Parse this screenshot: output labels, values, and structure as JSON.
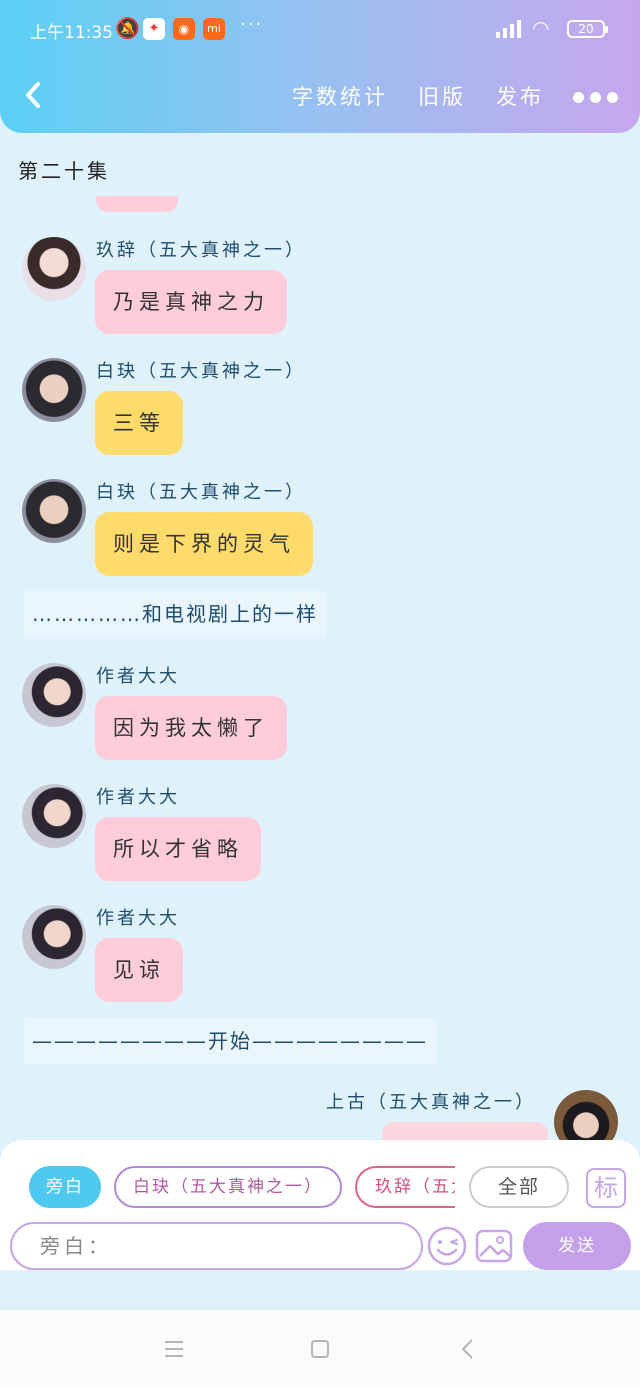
{
  "status_bar": {
    "time": "上午11:35",
    "battery": "20",
    "app_icons": [
      "app-icon-1",
      "app-icon-2",
      "mi-icon"
    ],
    "icon_names": [
      "bell-off-icon",
      "signal-icon",
      "wifi-icon",
      "battery-icon"
    ]
  },
  "nav": {
    "word_count": "字数统计",
    "old_version": "旧版",
    "publish": "发布"
  },
  "chapter_title": "第二十集",
  "messages": [
    {
      "sender": "玖辞（五大真神之一）",
      "text": "乃是真神之力",
      "color": "#fecdd9"
    },
    {
      "sender": "白玦（五大真神之一）",
      "text": "三等",
      "color": "#fedb6a"
    },
    {
      "sender": "白玦（五大真神之一）",
      "text": "则是下界的灵气",
      "color": "#fedb6a"
    },
    {
      "narration": "……………和电视剧上的一样"
    },
    {
      "sender": "作者大大",
      "text": "因为我太懒了",
      "color": "#fecdd9"
    },
    {
      "sender": "作者大大",
      "text": "所以才省略",
      "color": "#fecdd9"
    },
    {
      "sender": "作者大大",
      "text": "见谅",
      "color": "#fecdd9"
    },
    {
      "narration": "————————开始————————"
    },
    {
      "sender": "上古（五大真神之一）",
      "align": "right"
    }
  ],
  "role_chips": {
    "narrator": "旁白",
    "baijue": "白玦（五大真神之一）",
    "jiuci": "玖辞（五大",
    "all": "全部",
    "mark": "标"
  },
  "input": {
    "placeholder": "旁白：",
    "send": "发送"
  },
  "accent_colors": {
    "blue": "#4fc9ef",
    "purple": "#c4a0ea",
    "pink": "#fecdd9",
    "yellow": "#fedb6a"
  }
}
